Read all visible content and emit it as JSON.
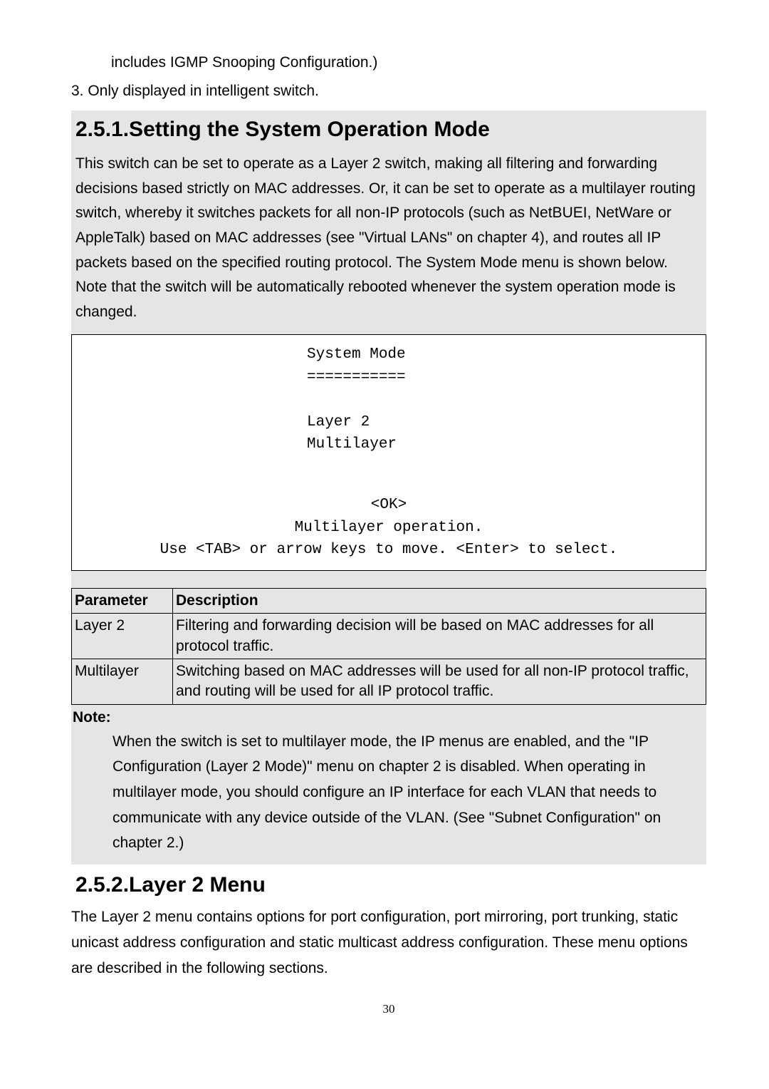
{
  "intro": {
    "carry_over": "includes IGMP Snooping Configuration.)",
    "list_item_3": "3.  Only displayed in intelligent switch."
  },
  "section_251": {
    "heading": "2.5.1.Setting the System Operation Mode",
    "body": "This switch can be set to operate as a Layer 2 switch, making all filtering and forwarding decisions based strictly on MAC addresses. Or, it can be set to operate as a multilayer routing switch, whereby it switches packets for all non-IP protocols (such as NetBUEI, NetWare or AppleTalk) based on MAC addresses (see \"Virtual LANs\" on chapter 4), and routes all IP packets based on the specified routing protocol. The System Mode menu is shown below. Note that the switch will be automatically rebooted whenever the system operation mode is changed."
  },
  "terminal": {
    "title": "System Mode",
    "underline": "===========",
    "opt1": "Layer 2",
    "opt2": "Multilayer",
    "ok": "<OK>",
    "sub": "Multilayer operation.",
    "hint": "Use <TAB> or arrow keys to move. <Enter> to select."
  },
  "param_table": {
    "headers": {
      "c1": "Parameter",
      "c2": "Description"
    },
    "rows": [
      {
        "c1": "Layer 2",
        "c2": "Filtering and forwarding decision will be based on MAC addresses for all protocol traffic."
      },
      {
        "c1": "Multilayer",
        "c2": "Switching based on MAC addresses will be used for all non-IP protocol traffic, and routing will be used for all IP protocol traffic."
      }
    ]
  },
  "note": {
    "label": "Note:",
    "body": "When the switch is set to multilayer mode, the IP menus are enabled, and the \"IP Configuration (Layer 2 Mode)\" menu on chapter 2 is disabled. When operating in multilayer mode, you should configure an IP interface for each VLAN that needs to communicate with any device outside of the VLAN. (See \"Subnet Configuration\" on chapter 2.)"
  },
  "section_252": {
    "heading": "2.5.2.Layer 2 Menu",
    "body": "The Layer 2 menu contains options for port configuration, port mirroring, port trunking, static unicast address configuration and static multicast address configuration. These menu options are described in the following sections."
  },
  "page_number": "30"
}
